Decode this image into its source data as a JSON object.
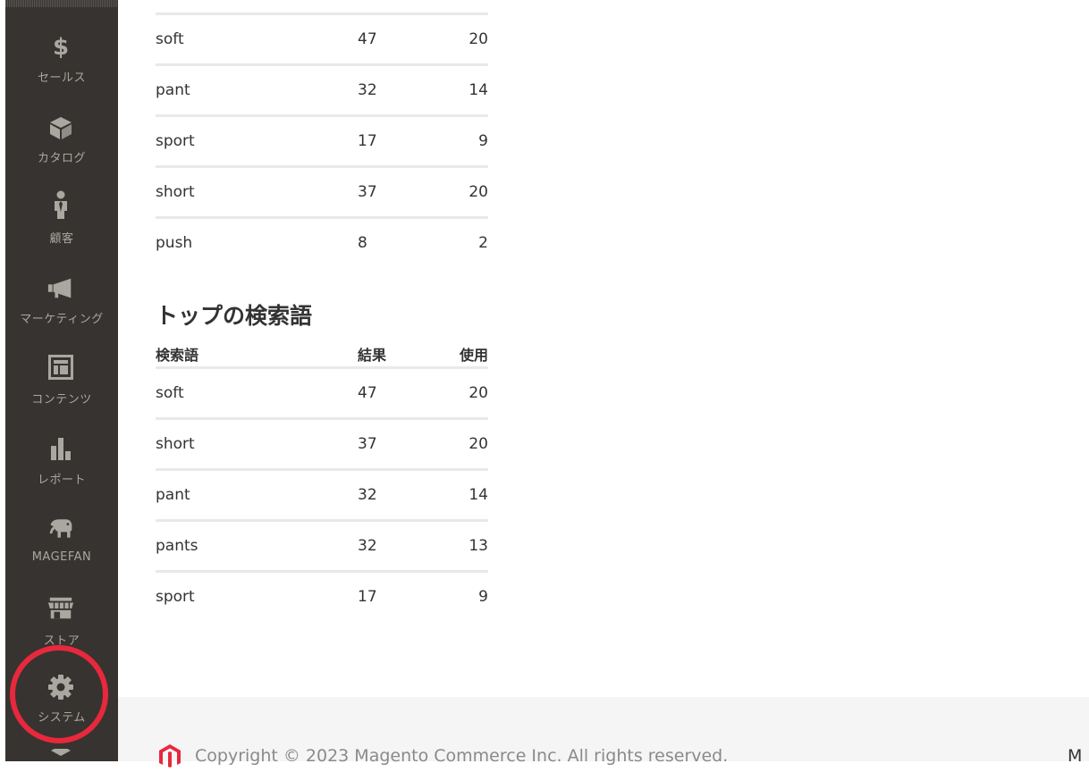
{
  "sidebar": {
    "items": [
      {
        "label": "セールス",
        "icon": "dollar-icon",
        "glyph": "$"
      },
      {
        "label": "カタログ",
        "icon": "box-icon"
      },
      {
        "label": "顧客",
        "icon": "person-icon"
      },
      {
        "label": "マーケティング",
        "icon": "megaphone-icon"
      },
      {
        "label": "コンテンツ",
        "icon": "layout-icon"
      },
      {
        "label": "レポート",
        "icon": "bar-chart-icon"
      },
      {
        "label": "MAGEFAN",
        "icon": "elephant-icon"
      },
      {
        "label": "ストア",
        "icon": "storefront-icon"
      },
      {
        "label": "システム",
        "icon": "gear-icon"
      }
    ],
    "highlight_color": "#e8283c",
    "background_color": "#373330"
  },
  "last_search_terms": {
    "rows": [
      {
        "term": "soft",
        "results": "47",
        "uses": "20"
      },
      {
        "term": "pant",
        "results": "32",
        "uses": "14"
      },
      {
        "term": "sport",
        "results": "17",
        "uses": "9"
      },
      {
        "term": "short",
        "results": "37",
        "uses": "20"
      },
      {
        "term": "push",
        "results": "8",
        "uses": "2"
      }
    ]
  },
  "top_search_terms": {
    "title": "トップの検索語",
    "columns": {
      "term": "検索語",
      "results": "結果",
      "uses": "使用"
    },
    "rows": [
      {
        "term": "soft",
        "results": "47",
        "uses": "20"
      },
      {
        "term": "short",
        "results": "37",
        "uses": "20"
      },
      {
        "term": "pant",
        "results": "32",
        "uses": "14"
      },
      {
        "term": "pants",
        "results": "32",
        "uses": "13"
      },
      {
        "term": "sport",
        "results": "17",
        "uses": "9"
      }
    ]
  },
  "footer": {
    "copyright": "Copyright © 2023 Magento Commerce Inc. All rights reserved.",
    "right_text": "M",
    "logo_color": "#e8283c"
  }
}
